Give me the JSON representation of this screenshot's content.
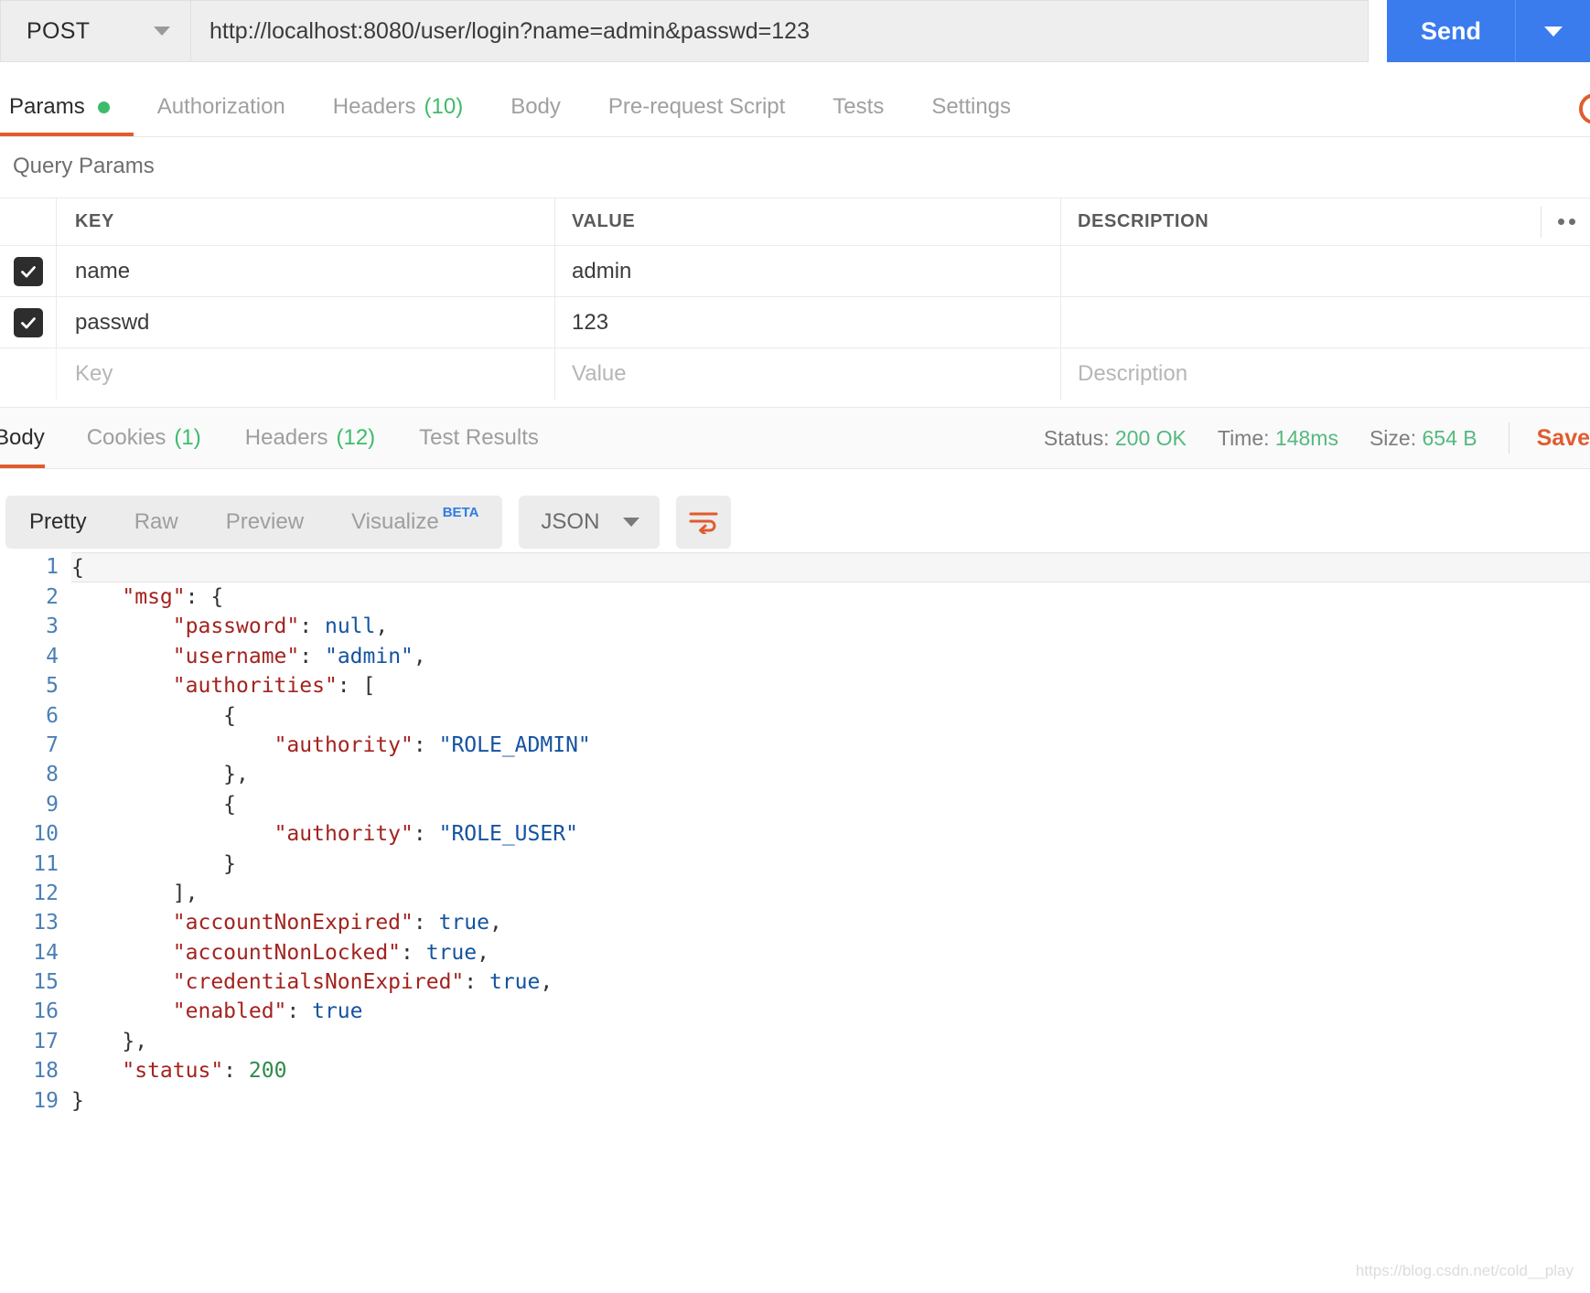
{
  "request": {
    "method": "POST",
    "url": "http://localhost:8080/user/login?name=admin&passwd=123",
    "send_label": "Send",
    "tabs": [
      {
        "label": "Params",
        "indicator": "dot"
      },
      {
        "label": "Authorization",
        "count": ""
      },
      {
        "label": "Headers",
        "count": "(10)"
      },
      {
        "label": "Body",
        "count": ""
      },
      {
        "label": "Pre-request Script",
        "count": ""
      },
      {
        "label": "Tests",
        "count": ""
      },
      {
        "label": "Settings",
        "count": ""
      }
    ],
    "active_tab": "Params"
  },
  "query_params": {
    "section_title": "Query Params",
    "columns": [
      "KEY",
      "VALUE",
      "DESCRIPTION"
    ],
    "rows": [
      {
        "checked": true,
        "key": "name",
        "value": "admin",
        "description": ""
      },
      {
        "checked": true,
        "key": "passwd",
        "value": "123",
        "description": ""
      }
    ],
    "placeholder_row": {
      "key": "Key",
      "value": "Value",
      "description": "Description"
    }
  },
  "response": {
    "tabs": [
      {
        "label": "Body",
        "count": ""
      },
      {
        "label": "Cookies",
        "count": "(1)"
      },
      {
        "label": "Headers",
        "count": "(12)"
      },
      {
        "label": "Test Results",
        "count": ""
      }
    ],
    "active_tab": "Body",
    "status_label": "Status:",
    "status_value": "200 OK",
    "time_label": "Time:",
    "time_value": "148ms",
    "size_label": "Size:",
    "size_value": "654 B",
    "save_label": "Save",
    "format_tabs": [
      "Pretty",
      "Raw",
      "Preview",
      "Visualize"
    ],
    "format_active": "Pretty",
    "beta_badge": "BETA",
    "language": "JSON"
  },
  "body_json": {
    "line_count": 19,
    "lines": [
      {
        "n": 1,
        "tokens": [
          {
            "t": "p",
            "v": "{"
          }
        ]
      },
      {
        "n": 2,
        "tokens": [
          {
            "t": "p",
            "v": "    "
          },
          {
            "t": "k",
            "v": "\"msg\""
          },
          {
            "t": "p",
            "v": ": {"
          }
        ]
      },
      {
        "n": 3,
        "tokens": [
          {
            "t": "p",
            "v": "        "
          },
          {
            "t": "k",
            "v": "\"password\""
          },
          {
            "t": "p",
            "v": ": "
          },
          {
            "t": "n",
            "v": "null"
          },
          {
            "t": "p",
            "v": ","
          }
        ]
      },
      {
        "n": 4,
        "tokens": [
          {
            "t": "p",
            "v": "        "
          },
          {
            "t": "k",
            "v": "\"username\""
          },
          {
            "t": "p",
            "v": ": "
          },
          {
            "t": "s",
            "v": "\"admin\""
          },
          {
            "t": "p",
            "v": ","
          }
        ]
      },
      {
        "n": 5,
        "tokens": [
          {
            "t": "p",
            "v": "        "
          },
          {
            "t": "k",
            "v": "\"authorities\""
          },
          {
            "t": "p",
            "v": ": ["
          }
        ]
      },
      {
        "n": 6,
        "tokens": [
          {
            "t": "p",
            "v": "            {"
          }
        ]
      },
      {
        "n": 7,
        "tokens": [
          {
            "t": "p",
            "v": "                "
          },
          {
            "t": "k",
            "v": "\"authority\""
          },
          {
            "t": "p",
            "v": ": "
          },
          {
            "t": "s",
            "v": "\"ROLE_ADMIN\""
          }
        ]
      },
      {
        "n": 8,
        "tokens": [
          {
            "t": "p",
            "v": "            },"
          }
        ]
      },
      {
        "n": 9,
        "tokens": [
          {
            "t": "p",
            "v": "            {"
          }
        ]
      },
      {
        "n": 10,
        "tokens": [
          {
            "t": "p",
            "v": "                "
          },
          {
            "t": "k",
            "v": "\"authority\""
          },
          {
            "t": "p",
            "v": ": "
          },
          {
            "t": "s",
            "v": "\"ROLE_USER\""
          }
        ]
      },
      {
        "n": 11,
        "tokens": [
          {
            "t": "p",
            "v": "            }"
          }
        ]
      },
      {
        "n": 12,
        "tokens": [
          {
            "t": "p",
            "v": "        ],"
          }
        ]
      },
      {
        "n": 13,
        "tokens": [
          {
            "t": "p",
            "v": "        "
          },
          {
            "t": "k",
            "v": "\"accountNonExpired\""
          },
          {
            "t": "p",
            "v": ": "
          },
          {
            "t": "n",
            "v": "true"
          },
          {
            "t": "p",
            "v": ","
          }
        ]
      },
      {
        "n": 14,
        "tokens": [
          {
            "t": "p",
            "v": "        "
          },
          {
            "t": "k",
            "v": "\"accountNonLocked\""
          },
          {
            "t": "p",
            "v": ": "
          },
          {
            "t": "n",
            "v": "true"
          },
          {
            "t": "p",
            "v": ","
          }
        ]
      },
      {
        "n": 15,
        "tokens": [
          {
            "t": "p",
            "v": "        "
          },
          {
            "t": "k",
            "v": "\"credentialsNonExpired\""
          },
          {
            "t": "p",
            "v": ": "
          },
          {
            "t": "n",
            "v": "true"
          },
          {
            "t": "p",
            "v": ","
          }
        ]
      },
      {
        "n": 16,
        "tokens": [
          {
            "t": "p",
            "v": "        "
          },
          {
            "t": "k",
            "v": "\"enabled\""
          },
          {
            "t": "p",
            "v": ": "
          },
          {
            "t": "n",
            "v": "true"
          }
        ]
      },
      {
        "n": 17,
        "tokens": [
          {
            "t": "p",
            "v": "    },"
          }
        ]
      },
      {
        "n": 18,
        "tokens": [
          {
            "t": "p",
            "v": "    "
          },
          {
            "t": "k",
            "v": "\"status\""
          },
          {
            "t": "p",
            "v": ": "
          },
          {
            "t": "num",
            "v": "200"
          }
        ]
      },
      {
        "n": 19,
        "tokens": [
          {
            "t": "p",
            "v": "}"
          }
        ]
      }
    ]
  },
  "watermark": "https://blog.csdn.net/cold__play",
  "colors": {
    "accent_orange": "#e05c2e",
    "send_blue": "#3a7bee",
    "status_green": "#53b97f",
    "json_key": "#a3231f",
    "json_string": "#1553a0",
    "json_number": "#2e8b4a"
  }
}
